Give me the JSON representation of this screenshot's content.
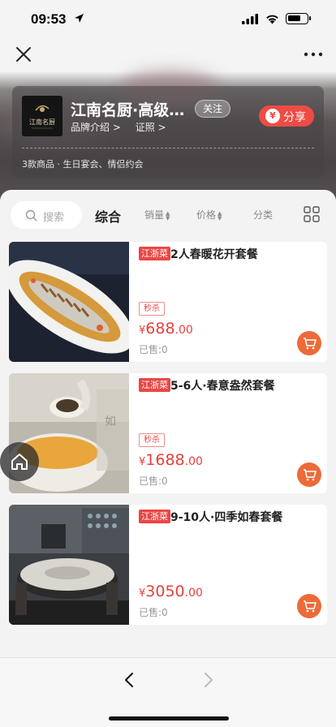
{
  "status_bar": {
    "time": "09:53",
    "battery_level": 0.68
  },
  "shop": {
    "name": "江南名厨·高级…",
    "logo_text": "江南名厨",
    "follow_label": "关注",
    "links": [
      "品牌介绍 >",
      "证照 >"
    ],
    "share_label": "分享",
    "share_icon_glyph": "¥",
    "description": "3款商品 · 生日宴会、情侣约会"
  },
  "toolbar": {
    "search_placeholder": "搜索",
    "sort_tabs": [
      {
        "label": "综合",
        "active": true
      },
      {
        "label": "销量",
        "arrows": "▲▼"
      },
      {
        "label": "价格",
        "arrows": "▲▼"
      },
      {
        "label": "分类"
      }
    ]
  },
  "products": [
    {
      "tag": "江浙菜",
      "title": "2人春暖花开套餐",
      "flash": "秒杀",
      "currency": "¥",
      "price_int": "688",
      "price_dec": ".00",
      "sold": "已售:0"
    },
    {
      "tag": "江浙菜",
      "title": "5-6人·春意盎然套餐",
      "flash": "秒杀",
      "currency": "¥",
      "price_int": "1688",
      "price_dec": ".00",
      "sold": "已售:0"
    },
    {
      "tag": "江浙菜",
      "title": "9-10人·四季如春套餐",
      "flash": "",
      "currency": "¥",
      "price_int": "3050",
      "price_dec": ".00",
      "sold": "已售:0"
    }
  ],
  "colors": {
    "accent_red": "#e7403c",
    "cart_orange": "#ec6b38",
    "tag_red": "#e94744"
  }
}
